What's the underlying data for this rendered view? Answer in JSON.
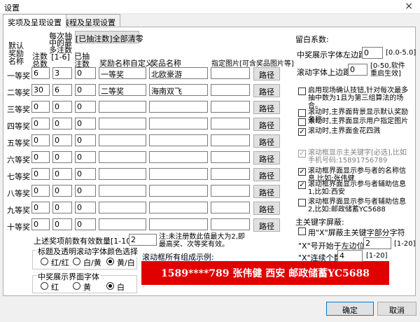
{
  "window": {
    "title": "设置",
    "close_glyph": "×"
  },
  "tabs": [
    {
      "label": "奖项及呈现设置"
    },
    {
      "label": "线程及呈现设置"
    }
  ],
  "grid": {
    "headers": {
      "name": "默认\n奖励\n名称",
      "total": "注数\n总数",
      "per_draw": "每次抽\n中的最\n多注数\n[1-6]",
      "drawn": "已抽\n注数",
      "custom": "奖励名称自定义",
      "prize": "奖品名称",
      "picture": "指定图片[可含奖品图片等]"
    },
    "clear_button": "[已抽注数]全部清零",
    "path_button": "路径",
    "rows": [
      {
        "name": "一等奖",
        "total": "6",
        "per_draw": "3",
        "drawn": "0",
        "custom": "一等奖",
        "prize": "北欧豪游"
      },
      {
        "name": "二等奖",
        "total": "30",
        "per_draw": "6",
        "drawn": "0",
        "custom": "二等奖",
        "prize": "海南双飞"
      },
      {
        "name": "三等奖",
        "total": "0",
        "per_draw": "0",
        "drawn": "0",
        "custom": "",
        "prize": ""
      },
      {
        "name": "四等奖",
        "total": "0",
        "per_draw": "0",
        "drawn": "0",
        "custom": "",
        "prize": ""
      },
      {
        "name": "五等奖",
        "total": "0",
        "per_draw": "0",
        "drawn": "0",
        "custom": "",
        "prize": ""
      },
      {
        "name": "六等奖",
        "total": "0",
        "per_draw": "0",
        "drawn": "0",
        "custom": "",
        "prize": ""
      },
      {
        "name": "七等奖",
        "total": "0",
        "per_draw": "0",
        "drawn": "0",
        "custom": "",
        "prize": ""
      },
      {
        "name": "八等奖",
        "total": "0",
        "per_draw": "0",
        "drawn": "0",
        "custom": "",
        "prize": ""
      },
      {
        "name": "九等奖",
        "total": "0",
        "per_draw": "0",
        "drawn": "0",
        "custom": "",
        "prize": ""
      },
      {
        "name": "十等奖",
        "total": "0",
        "per_draw": "0",
        "drawn": "0",
        "custom": "",
        "prize": ""
      }
    ]
  },
  "bottom": {
    "valid_count_label": "上述奖项前数有效数量[1-10]:",
    "valid_count_value": "2",
    "valid_count_note": "注:未注册数此值最大为2,即最高奖、次等奖有效。",
    "title_color_group": "标题及透明滚动字体颜色选择",
    "title_color_options": [
      {
        "label": "红/红",
        "selected": false
      },
      {
        "label": "白/黄",
        "selected": false
      },
      {
        "label": "黄/白",
        "selected": true
      }
    ],
    "winner_font_group": "中奖展示界面字体",
    "winner_font_options": [
      {
        "label": "红",
        "selected": false
      },
      {
        "label": "黄",
        "selected": false
      },
      {
        "label": "白",
        "selected": true
      }
    ],
    "sample_label": "滚动框所有组成示例:",
    "sample_text": "1589****789  张伟健  西安  邮政储蓄YC5688"
  },
  "right": {
    "margin_title": "留白系数:",
    "left_margin_label": "中奖展示字体左边距:",
    "left_margin_value": "0",
    "left_margin_range": "[0.0-5.0]",
    "top_margin_label": "滚动字体上边距:",
    "top_margin_value": "0",
    "top_margin_note": "[0-50,软件重启生效]",
    "options": [
      {
        "label": "启用现场确认技钮,针对每次最多抽中数为1且为第三组算法的场合。",
        "checked": false,
        "disabled": false
      },
      {
        "label": "滚动时,主界面背景显示默认奖励名称",
        "checked": false,
        "disabled": false
      },
      {
        "label": "滚动时,主界面显示用户指定图片",
        "checked": false,
        "disabled": false
      },
      {
        "label": "滚动时,主界面金花四溅",
        "checked": true,
        "disabled": false
      },
      {
        "label": "滚动框显示主关键字[必选],比如手机号码:15891756789",
        "checked": true,
        "disabled": true
      },
      {
        "label": "滚动框界面显示参与者的名称信息,比如:张伟健",
        "checked": true,
        "disabled": false
      },
      {
        "label": "滚动框界面显示参与者辅助信息1,比如:西安",
        "checked": true,
        "disabled": false
      },
      {
        "label": "滚动框界面显示参与者辅助信息2,比如:邮政储蓄YC5688",
        "checked": false,
        "disabled": false
      }
    ],
    "mask_title": "主关键字屏蔽:",
    "mask_check_label": "用\"X\"屏蔽主关键字部分字符",
    "mask_check_checked": false,
    "mask_start_label": "\"X\"号开始于左边位置:",
    "mask_start_value": "2",
    "mask_start_range": "[1-20]",
    "mask_count_label": "\"X\"连续个数:",
    "mask_count_value": "4",
    "mask_count_range": "[1-20]"
  },
  "footer": {
    "ok": "确定",
    "cancel": "取消"
  }
}
